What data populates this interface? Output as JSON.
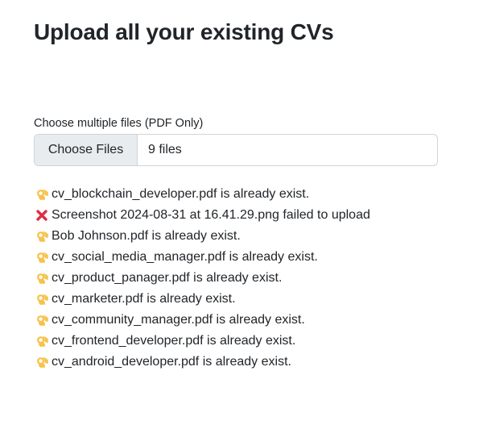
{
  "page": {
    "title": "Upload all your existing CVs"
  },
  "upload": {
    "label": "Choose multiple files (PDF Only)",
    "button_label": "Choose Files",
    "file_count": "9 files"
  },
  "results": [
    {
      "status": "exists",
      "icon": "ok-hand-icon",
      "text": "cv_blockchain_developer.pdf is already exist."
    },
    {
      "status": "failed",
      "icon": "cross-mark-icon",
      "text": "Screenshot 2024-08-31 at 16.41.29.png failed to upload"
    },
    {
      "status": "exists",
      "icon": "ok-hand-icon",
      "text": "Bob Johnson.pdf is already exist."
    },
    {
      "status": "exists",
      "icon": "ok-hand-icon",
      "text": "cv_social_media_manager.pdf is already exist."
    },
    {
      "status": "exists",
      "icon": "ok-hand-icon",
      "text": "cv_product_panager.pdf is already exist."
    },
    {
      "status": "exists",
      "icon": "ok-hand-icon",
      "text": "cv_marketer.pdf is already exist."
    },
    {
      "status": "exists",
      "icon": "ok-hand-icon",
      "text": "cv_community_manager.pdf is already exist."
    },
    {
      "status": "exists",
      "icon": "ok-hand-icon",
      "text": "cv_frontend_developer.pdf is already exist."
    },
    {
      "status": "exists",
      "icon": "ok-hand-icon",
      "text": "cv_android_developer.pdf is already exist."
    }
  ],
  "colors": {
    "text": "#212529",
    "button_bg": "#e9ecef",
    "border": "#ced4da",
    "error_red": "#dd2e44",
    "ok_hand_yellow": "#f7c24a"
  }
}
